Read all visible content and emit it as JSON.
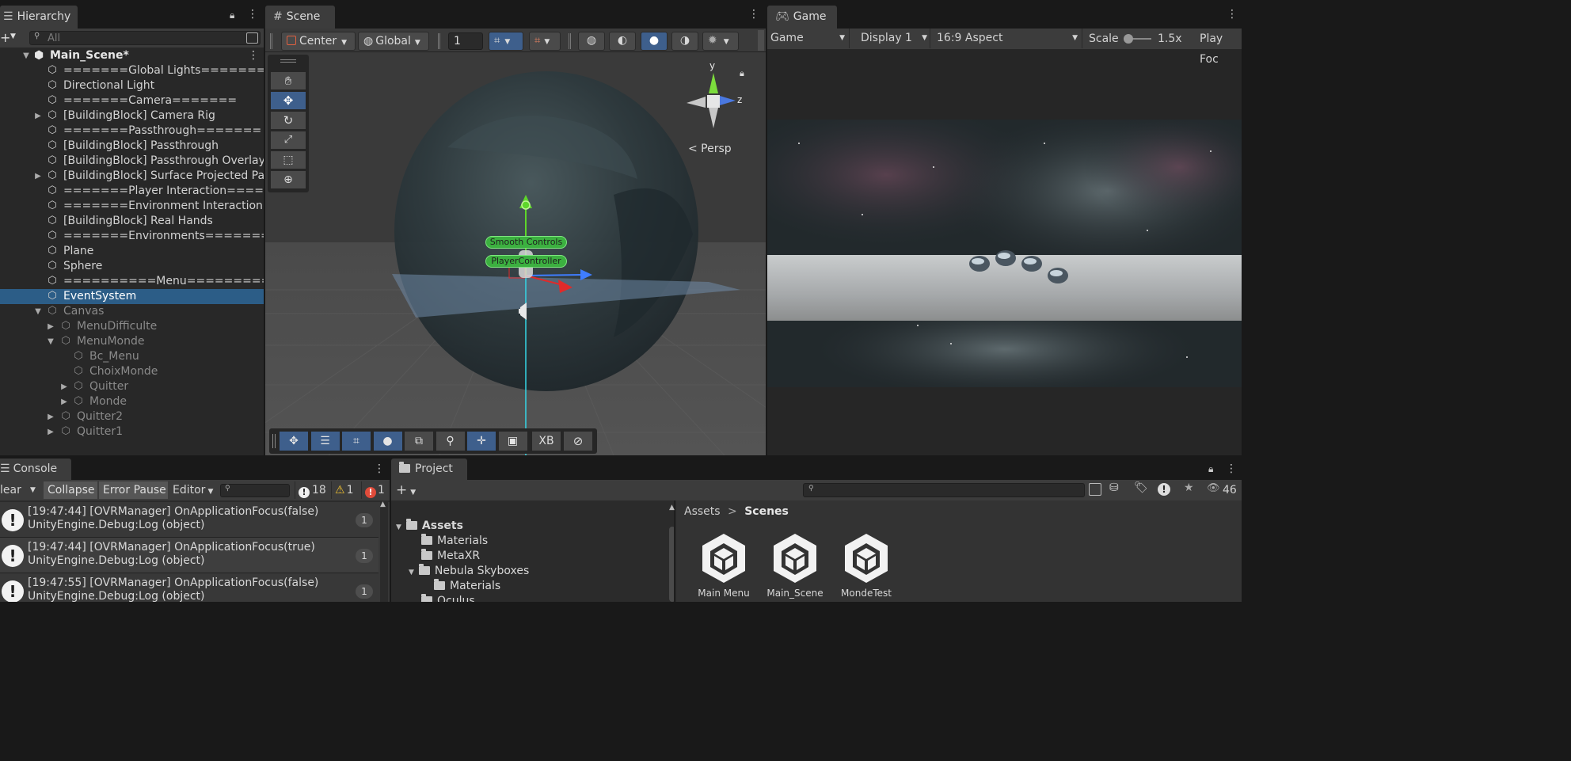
{
  "hierarchy": {
    "tab": "Hierarchy",
    "search_placeholder": "All",
    "scene_name": "Main_Scene*",
    "rows": [
      {
        "label": "=======Global Lights======="
      },
      {
        "label": "Directional Light"
      },
      {
        "label": "=======Camera======="
      },
      {
        "label": "[BuildingBlock] Camera Rig"
      },
      {
        "label": "=======Passthrough======="
      },
      {
        "label": "[BuildingBlock] Passthrough"
      },
      {
        "label": "[BuildingBlock] Passthrough Overlay"
      },
      {
        "label": "[BuildingBlock] Surface Projected Pas"
      },
      {
        "label": "=======Player Interaction======="
      },
      {
        "label": "=======Environment Interaction==="
      },
      {
        "label": "[BuildingBlock] Real Hands"
      },
      {
        "label": "=======Environments======="
      },
      {
        "label": "Plane"
      },
      {
        "label": "Sphere"
      },
      {
        "label": "==========Menu=========="
      },
      {
        "label": "EventSystem"
      },
      {
        "label": "Canvas"
      },
      {
        "label": "MenuDifficulte"
      },
      {
        "label": "MenuMonde"
      },
      {
        "label": "Bc_Menu"
      },
      {
        "label": "ChoixMonde"
      },
      {
        "label": "Quitter"
      },
      {
        "label": "Monde"
      },
      {
        "label": "Quitter2"
      },
      {
        "label": "Quitter1"
      }
    ]
  },
  "scene": {
    "tab": "Scene",
    "pivot_mode": "Center",
    "pivot_rotation": "Global",
    "grid_snap_value": "1",
    "gizmo_y": "y",
    "gizmo_z": "z",
    "projection": "< Persp",
    "label_smooth": "Smooth Controls",
    "label_player": "PlayerController",
    "bottom_xb": "XB",
    "colors": {
      "sky_bg": "#3a3a3a",
      "ground": "#505050",
      "plane": "#6f8aa8",
      "y_axis": "#5ed62a",
      "z_axis": "#3f7dff",
      "x_axis": "#e02a2a",
      "vertical_line": "#35d6e6"
    }
  },
  "game": {
    "tab": "Game",
    "mode": "Game",
    "display": "Display 1",
    "aspect": "16:9 Aspect",
    "scale_label": "Scale",
    "scale_value": "1.5x",
    "play_focus": "Play Foc"
  },
  "console": {
    "tab": "Console",
    "clear": "lear",
    "collapse": "Collapse",
    "error_pause": "Error Pause",
    "editor": "Editor",
    "log_count": "18",
    "warn_count": "1",
    "error_count": "1",
    "entries": [
      {
        "line1": "[19:47:44] [OVRManager] OnApplicationFocus(false)",
        "line2": "UnityEngine.Debug:Log (object)",
        "count": "1"
      },
      {
        "line1": "[19:47:44] [OVRManager] OnApplicationFocus(true)",
        "line2": "UnityEngine.Debug:Log (object)",
        "count": "1"
      },
      {
        "line1": "[19:47:55] [OVRManager] OnApplicationFocus(false)",
        "line2": "UnityEngine.Debug:Log (object)",
        "count": "1"
      }
    ]
  },
  "project": {
    "tab": "Project",
    "tree": [
      {
        "label": "Assets"
      },
      {
        "label": "Materials"
      },
      {
        "label": "MetaXR"
      },
      {
        "label": "Nebula Skyboxes"
      },
      {
        "label": "Materials"
      },
      {
        "label": "Oculus"
      }
    ],
    "breadcrumb_root": "Assets",
    "breadcrumb_sep": ">",
    "breadcrumb_current": "Scenes",
    "visible_count": "46",
    "assets": [
      {
        "label": "Main Menu"
      },
      {
        "label": "Main_Scene"
      },
      {
        "label": "MondeTest"
      }
    ]
  }
}
